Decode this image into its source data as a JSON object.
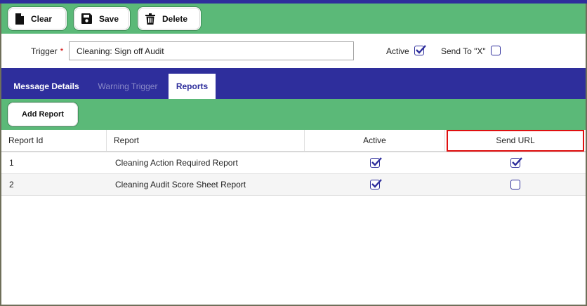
{
  "toolbar": {
    "clear_label": "Clear",
    "save_label": "Save",
    "delete_label": "Delete"
  },
  "trigger": {
    "label": "Trigger",
    "required_mark": "*",
    "value": "Cleaning: Sign off Audit",
    "active_label": "Active",
    "active_checked": true,
    "send_to_x_label": "Send To \"X\"",
    "send_to_x_checked": false
  },
  "tabs": [
    {
      "label": "Message Details",
      "state": "inactive"
    },
    {
      "label": "Warning Trigger",
      "state": "disabled"
    },
    {
      "label": "Reports",
      "state": "selected"
    }
  ],
  "reports": {
    "add_label": "Add Report",
    "columns": [
      "Report Id",
      "Report",
      "Active",
      "Send URL"
    ],
    "rows": [
      {
        "id": "1",
        "report": "Cleaning Action Required Report",
        "active": true,
        "send_url": true
      },
      {
        "id": "2",
        "report": "Cleaning Audit Score Sheet Report",
        "active": true,
        "send_url": false
      }
    ]
  },
  "colors": {
    "primary": "#2e2e9c",
    "toolbar_green": "#5bb978",
    "highlight_red": "#e01010"
  }
}
